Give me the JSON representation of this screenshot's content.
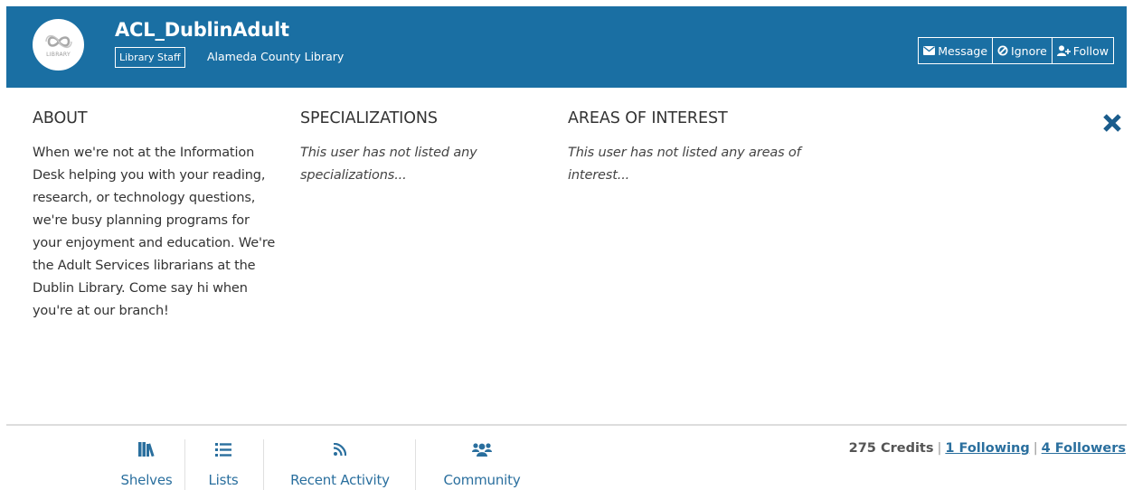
{
  "profile": {
    "username": "ACL_DublinAdult",
    "role_badge": "Library Staff",
    "library": "Alameda County Library",
    "avatar_icon": "library-logo-icon",
    "avatar_text": "LIBRARY"
  },
  "actions": [
    {
      "label": "Message",
      "icon": "envelope-icon"
    },
    {
      "label": "Ignore",
      "icon": "ban-icon"
    },
    {
      "label": "Follow",
      "icon": "user-plus-icon"
    }
  ],
  "about": {
    "heading": "ABOUT",
    "text": "When we're not at the Information Desk helping you with your reading, research, or technology questions, we're busy planning programs for your enjoyment and education. We're the Adult Services librarians at the Dublin Library. Come say hi when you're at our branch!"
  },
  "specializations": {
    "heading": "SPECIALIZATIONS",
    "empty": "This user has not listed any specializations..."
  },
  "interests": {
    "heading": "AREAS OF INTEREST",
    "empty": "This user has not listed any areas of interest..."
  },
  "close_icon": "close-icon",
  "nav": [
    {
      "label": "Shelves",
      "icon": "books-icon"
    },
    {
      "label": "Lists",
      "icon": "list-icon"
    },
    {
      "label": "Recent Activity",
      "icon": "rss-icon"
    },
    {
      "label": "Community",
      "icon": "users-icon"
    }
  ],
  "stats": {
    "credits": "275 Credits",
    "following": "1 Following",
    "followers": "4 Followers"
  },
  "colors": {
    "banner": "#1a6fa3",
    "link": "#2a6f9e",
    "close": "#1a5c8c"
  }
}
